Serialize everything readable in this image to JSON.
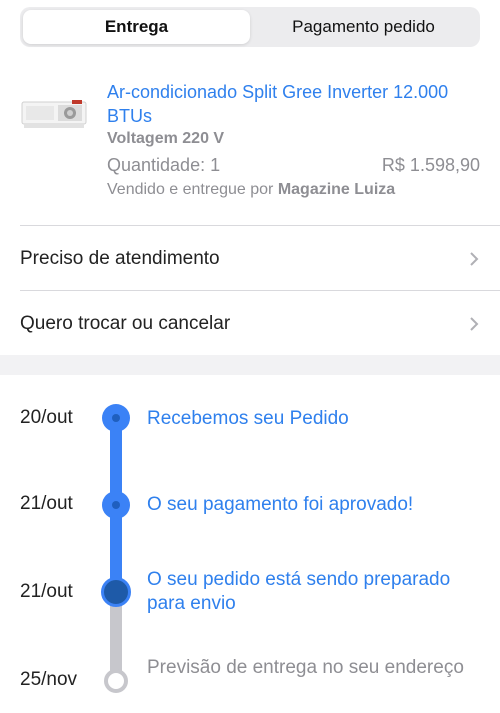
{
  "tabs": [
    {
      "label": "Entrega",
      "active": true
    },
    {
      "label": "Pagamento pedido",
      "active": false
    }
  ],
  "product": {
    "title": "Ar-condicionado Split Gree Inverter 12.000 BTUs",
    "voltage": "Voltagem 220 V",
    "quantity": "Quantidade: 1",
    "price": "R$ 1.598,90",
    "seller_prefix": "Vendido e entregue por",
    "seller_name": "Magazine Luiza",
    "image_icon": "air-conditioner-icon"
  },
  "menu": [
    {
      "label": "Preciso de atendimento"
    },
    {
      "label": "Quero trocar ou cancelar"
    }
  ],
  "timeline": [
    {
      "date": "20/out",
      "label": "Recebemos seu Pedido",
      "status": "done"
    },
    {
      "date": "21/out",
      "label": "O seu pagamento foi aprovado!",
      "status": "done"
    },
    {
      "date": "21/out",
      "label": "O seu pedido está sendo preparado para envio",
      "status": "current"
    },
    {
      "date": "25/nov",
      "label": "Previsão de entrega no seu endereço",
      "status": "pending"
    }
  ],
  "colors": {
    "accent": "#2f80ed",
    "timeline_active": "#3b82f6",
    "timeline_pending": "#c7c7cc",
    "muted_text": "#8e8e93"
  }
}
